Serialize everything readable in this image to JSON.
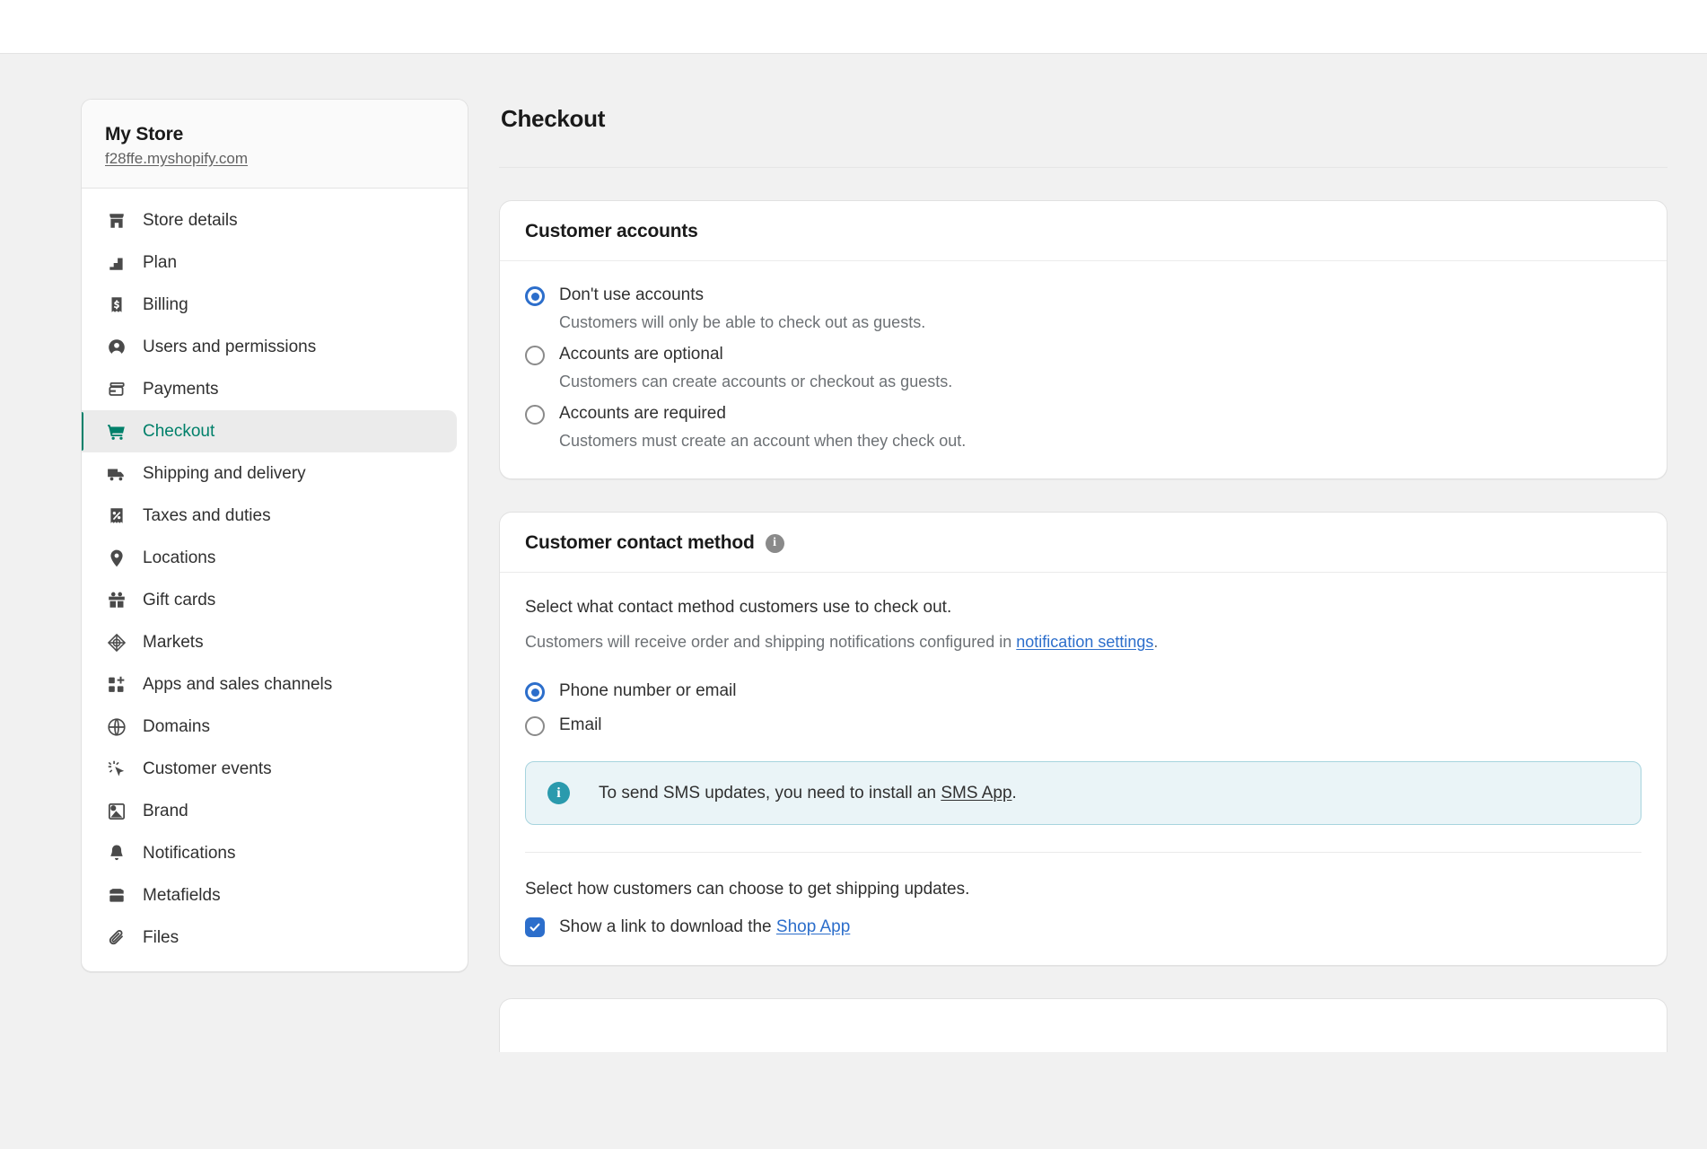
{
  "store": {
    "name": "My Store",
    "url": "f28ffe.myshopify.com"
  },
  "sidebar": {
    "items": [
      {
        "label": "Store details",
        "icon": "store-icon",
        "active": false
      },
      {
        "label": "Plan",
        "icon": "plan-icon",
        "active": false
      },
      {
        "label": "Billing",
        "icon": "billing-icon",
        "active": false
      },
      {
        "label": "Users and permissions",
        "icon": "users-icon",
        "active": false
      },
      {
        "label": "Payments",
        "icon": "payments-icon",
        "active": false
      },
      {
        "label": "Checkout",
        "icon": "checkout-cart-icon",
        "active": true
      },
      {
        "label": "Shipping and delivery",
        "icon": "truck-icon",
        "active": false
      },
      {
        "label": "Taxes and duties",
        "icon": "taxes-icon",
        "active": false
      },
      {
        "label": "Locations",
        "icon": "location-pin-icon",
        "active": false
      },
      {
        "label": "Gift cards",
        "icon": "gift-icon",
        "active": false
      },
      {
        "label": "Markets",
        "icon": "markets-icon",
        "active": false
      },
      {
        "label": "Apps and sales channels",
        "icon": "apps-icon",
        "active": false
      },
      {
        "label": "Domains",
        "icon": "globe-icon",
        "active": false
      },
      {
        "label": "Customer events",
        "icon": "customer-events-icon",
        "active": false
      },
      {
        "label": "Brand",
        "icon": "brand-icon",
        "active": false
      },
      {
        "label": "Notifications",
        "icon": "bell-icon",
        "active": false
      },
      {
        "label": "Metafields",
        "icon": "metafields-icon",
        "active": false
      },
      {
        "label": "Files",
        "icon": "paperclip-icon",
        "active": false
      }
    ]
  },
  "main": {
    "page_title": "Checkout",
    "customer_accounts": {
      "title": "Customer accounts",
      "options": [
        {
          "label": "Don't use accounts",
          "help": "Customers will only be able to check out as guests.",
          "selected": true
        },
        {
          "label": "Accounts are optional",
          "help": "Customers can create accounts or checkout as guests.",
          "selected": false
        },
        {
          "label": "Accounts are required",
          "help": "Customers must create an account when they check out.",
          "selected": false
        }
      ]
    },
    "contact_method": {
      "title": "Customer contact method",
      "info_icon": "info-icon",
      "intro": "Select what contact method customers use to check out.",
      "sub_prefix": "Customers will receive order and shipping notifications configured in ",
      "sub_link": "notification settings",
      "sub_suffix": ".",
      "options": [
        {
          "label": "Phone number or email",
          "selected": true
        },
        {
          "label": "Email",
          "selected": false
        }
      ],
      "banner": {
        "icon": "info-icon",
        "prefix": "To send SMS updates, you need to install an ",
        "link": "SMS App",
        "suffix": "."
      },
      "shipping_updates_text": "Select how customers can choose to get shipping updates.",
      "shop_app_checkbox": {
        "prefix": "Show a link to download the ",
        "link": "Shop App",
        "checked": true
      }
    }
  },
  "colors": {
    "accent_green": "#00806a",
    "accent_blue": "#2c6ecb",
    "banner_bg": "#eaf4f7",
    "banner_border": "#a7d4de",
    "banner_icon": "#2a9aad"
  }
}
